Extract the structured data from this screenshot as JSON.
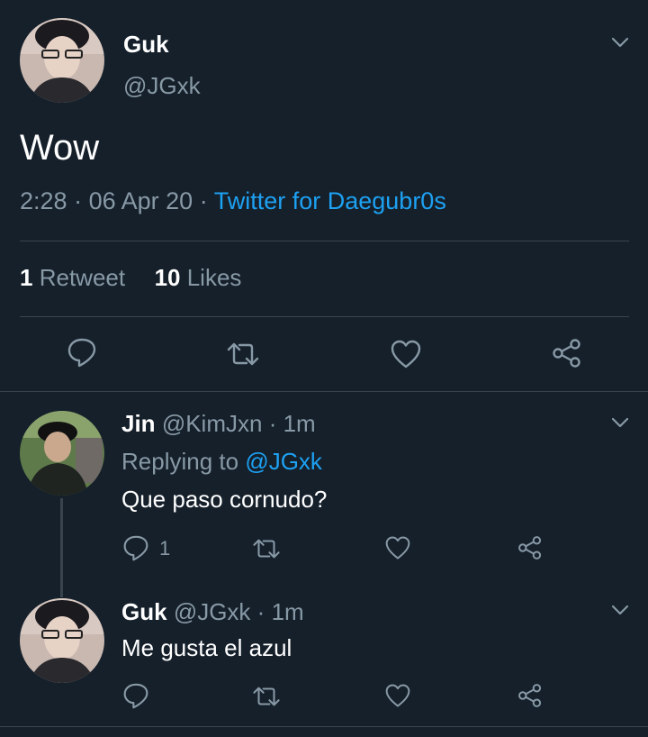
{
  "tweet": {
    "author_name": "Guk",
    "author_handle": "@JGxk",
    "text": "Wow",
    "time": "2:28",
    "date": "06 Apr 20",
    "source": "Twitter for Daegubr0s",
    "retweet_count": "1",
    "retweet_label": "Retweet",
    "like_count": "10",
    "like_label": "Likes"
  },
  "replies": [
    {
      "name": "Jin",
      "handle": "@KimJxn",
      "time": "1m",
      "replying_to_label": "Replying to",
      "replying_to_handle": "@JGxk",
      "text": "Que paso cornudo?",
      "reply_count": "1"
    },
    {
      "name": "Guk",
      "handle": "@JGxk",
      "time": "1m",
      "text": "Me gusta el azul"
    }
  ],
  "separators": {
    "dot": "·"
  },
  "icons": {
    "menu": "chevron-down-icon",
    "reply": "reply-icon",
    "retweet": "retweet-icon",
    "like": "heart-icon",
    "share": "share-icon"
  },
  "colors": {
    "background": "#15202b",
    "accent": "#1da1f2",
    "secondary_text": "#8899a6",
    "divider": "#38444d"
  }
}
